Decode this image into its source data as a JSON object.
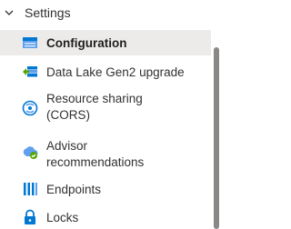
{
  "group": {
    "label": "Settings",
    "icon": "chevron-down-icon"
  },
  "items": [
    {
      "label": "Configuration",
      "icon": "configuration-icon",
      "selected": true
    },
    {
      "label": "Data Lake Gen2 upgrade",
      "icon": "upgrade-icon",
      "selected": false
    },
    {
      "label_line1": "Resource sharing",
      "label_line2": "(CORS)",
      "icon": "cors-icon",
      "selected": false
    },
    {
      "label_line1": "Advisor",
      "label_line2": "recommendations",
      "icon": "advisor-icon",
      "selected": false
    },
    {
      "label": "Endpoints",
      "icon": "endpoints-icon",
      "selected": false
    },
    {
      "label": "Locks",
      "icon": "lock-icon",
      "selected": false
    }
  ],
  "colors": {
    "selected_bg": "#edebe9",
    "text": "#323130",
    "azure_blue": "#0078d4",
    "green": "#57a300",
    "scroll_thumb": "#8a8886"
  }
}
